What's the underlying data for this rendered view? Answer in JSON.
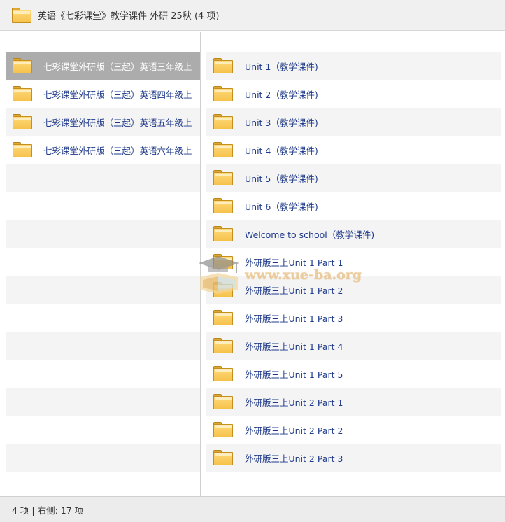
{
  "window": {
    "title": "英语《七彩课堂》教学课件 外研 25秋 (4 项)",
    "title_icon": "folder-icon"
  },
  "left_pane": {
    "items": [
      {
        "label": "七彩课堂外研版（三起）英语三年级上",
        "icon": "folder-icon",
        "selected": true
      },
      {
        "label": "七彩课堂外研版（三起）英语四年级上",
        "icon": "folder-icon"
      },
      {
        "label": "七彩课堂外研版（三起）英语五年级上",
        "icon": "folder-icon"
      },
      {
        "label": "七彩课堂外研版（三起）英语六年级上",
        "icon": "folder-icon"
      }
    ]
  },
  "right_pane": {
    "items": [
      {
        "label": "Unit 1（教学课件)",
        "icon": "folder-icon"
      },
      {
        "label": "Unit 2（教学课件)",
        "icon": "folder-icon"
      },
      {
        "label": "Unit 3（教学课件)",
        "icon": "folder-icon"
      },
      {
        "label": "Unit 4（教学课件)",
        "icon": "folder-icon"
      },
      {
        "label": "Unit 5（教学课件)",
        "icon": "folder-icon"
      },
      {
        "label": "Unit 6（教学课件)",
        "icon": "folder-icon"
      },
      {
        "label": "Welcome to school（教学课件)",
        "icon": "folder-icon"
      },
      {
        "label": "外研版三上Unit 1 Part 1",
        "icon": "folder-icon"
      },
      {
        "label": "外研版三上Unit 1 Part 2",
        "icon": "folder-icon"
      },
      {
        "label": "外研版三上Unit 1 Part 3",
        "icon": "folder-icon"
      },
      {
        "label": "外研版三上Unit 1 Part 4",
        "icon": "folder-icon"
      },
      {
        "label": "外研版三上Unit 1 Part 5",
        "icon": "folder-icon"
      },
      {
        "label": "外研版三上Unit 2 Part 1",
        "icon": "folder-icon"
      },
      {
        "label": "外研版三上Unit 2 Part 2",
        "icon": "folder-icon"
      },
      {
        "label": "外研版三上Unit 2 Part 3",
        "icon": "folder-icon"
      }
    ]
  },
  "statusbar": {
    "text": "4 项 | 右侧: 17 项"
  },
  "watermark": {
    "text": "www.xue-ba.org",
    "icon": "graduation-cap-book-icon"
  },
  "colors": {
    "link_text": "#1f3a8a",
    "selected_row": "#acacac",
    "folder_yellow": "#f6c24c",
    "watermark": "#e9c58f"
  }
}
